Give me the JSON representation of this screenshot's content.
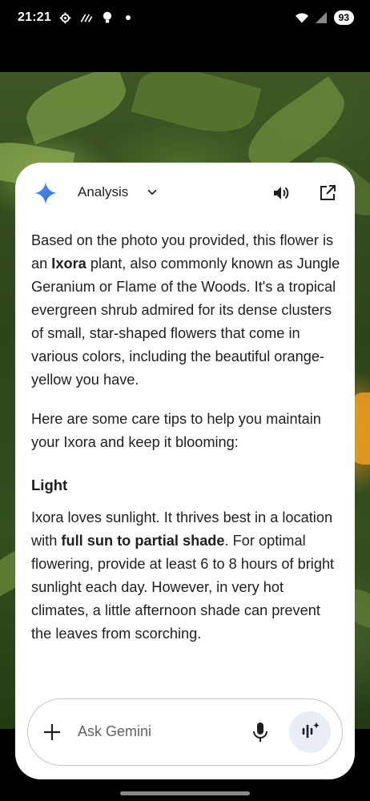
{
  "status_bar": {
    "time": "21:21",
    "battery": "93",
    "icons": [
      "gear-icon",
      "hotspot-icon",
      "bulb-icon",
      "dot-icon",
      "wifi-icon",
      "signal-icon"
    ]
  },
  "card": {
    "mode_label": "Analysis",
    "header_icons": [
      "gemini-sparkle-icon",
      "chevron-down-icon",
      "speaker-icon",
      "open-external-icon"
    ],
    "paragraph1": {
      "before": "Based on the photo you provided, this flower is an ",
      "bold": "Ixora",
      "after": " plant, also commonly known as Jungle Geranium or Flame of the Woods. It's a tropical evergreen shrub admired for its dense clusters of small, star-shaped flowers that come in various colors, including the beautiful orange-yellow you have."
    },
    "paragraph2": "Here are some care tips to help you maintain your Ixora and keep it blooming:",
    "section_heading": "Light",
    "paragraph3": {
      "before": "Ixora loves sunlight. It thrives best in a location with ",
      "bold": "full sun to partial shade",
      "after": ". For optimal flowering, provide at least 6 to 8 hours of bright sunlight each day. However, in very hot climates, a little afternoon shade can prevent the leaves from scorching."
    }
  },
  "input": {
    "placeholder": "Ask Gemini",
    "icons": [
      "plus-icon",
      "mic-icon",
      "live-icon"
    ]
  },
  "colors": {
    "accent_blue": "#4285f4",
    "text": "#1f1f1f",
    "placeholder": "#5f6368",
    "live_button_bg": "#e9eef6"
  }
}
